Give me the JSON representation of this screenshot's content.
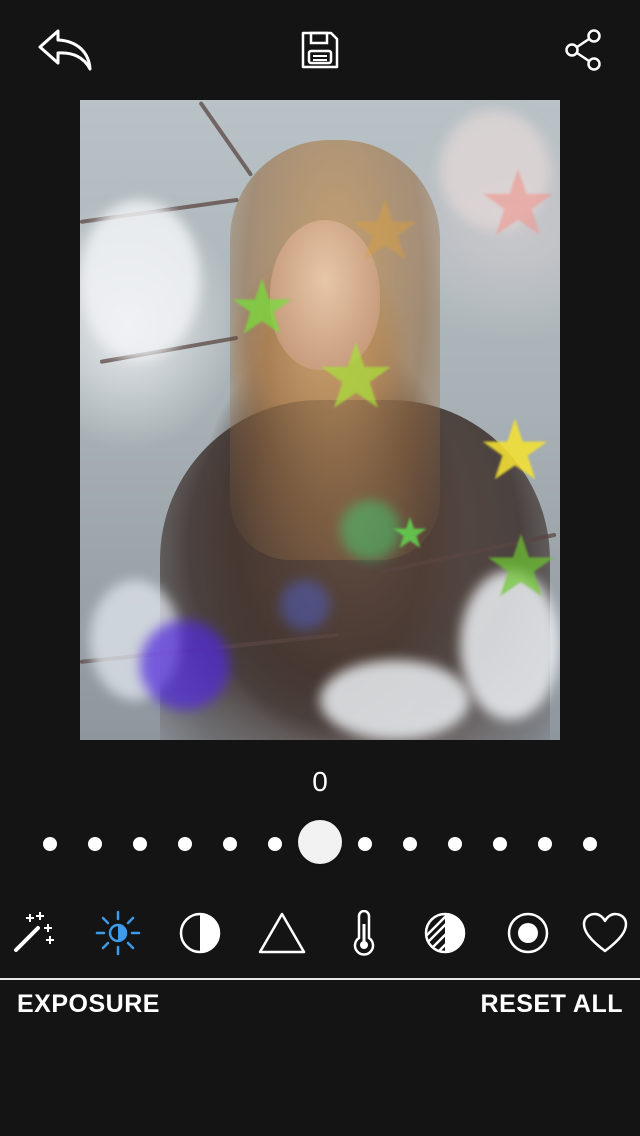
{
  "toolbar": {
    "back_icon": "undo-arrow-icon",
    "save_icon": "floppy-disk-icon",
    "share_icon": "share-icon"
  },
  "adjustment": {
    "value": "0",
    "slider_position": 0.5,
    "slider_stops": 13
  },
  "tools": [
    {
      "name": "magic-wand-icon",
      "active": false
    },
    {
      "name": "brightness-icon",
      "active": true
    },
    {
      "name": "contrast-icon",
      "active": false
    },
    {
      "name": "triangle-icon",
      "active": false
    },
    {
      "name": "thermometer-icon",
      "active": false
    },
    {
      "name": "striped-circle-icon",
      "active": false
    },
    {
      "name": "vignette-icon",
      "active": false
    },
    {
      "name": "heart-icon",
      "active": false
    }
  ],
  "labels": {
    "current_tool": "EXPOSURE",
    "reset": "RESET ALL"
  },
  "colors": {
    "background": "#141414",
    "accent": "#3d9be9",
    "foreground": "#ffffff"
  }
}
